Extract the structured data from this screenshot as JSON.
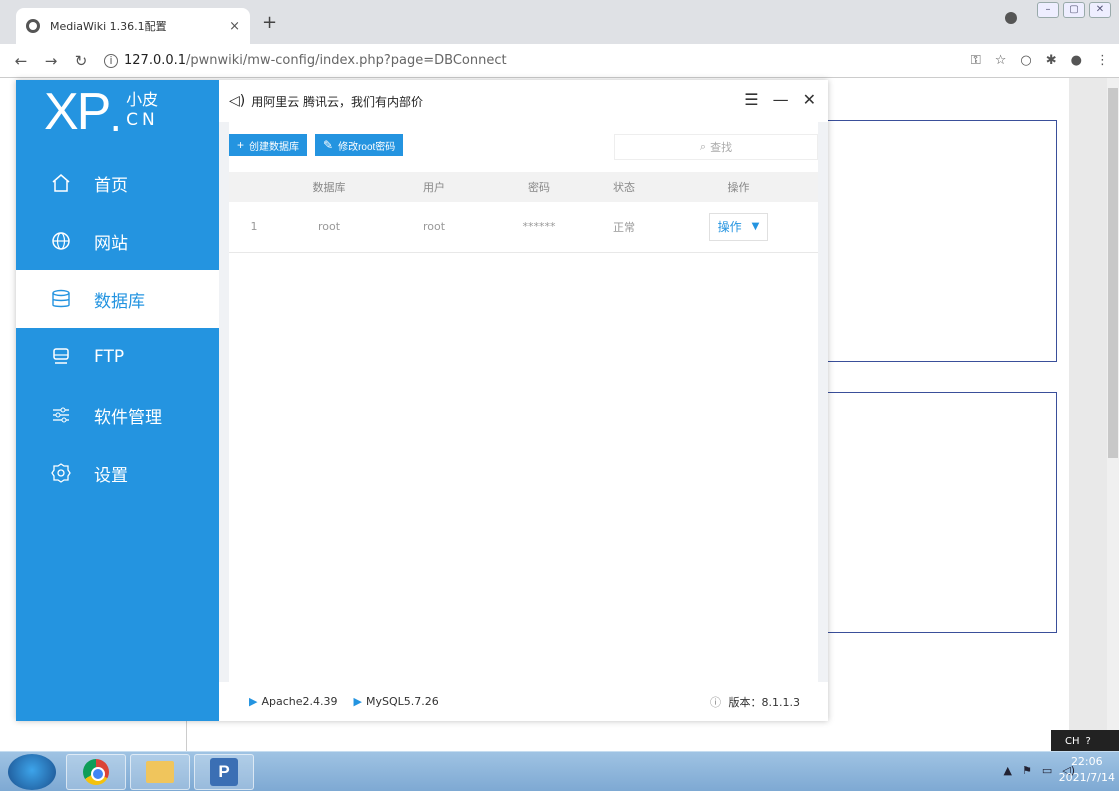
{
  "browser": {
    "tab_title": "MediaWiki 1.36.1配置",
    "tab_close": "×",
    "new_tab": "+",
    "url_host": "127.0.0.1",
    "url_path": "/pwnwiki/mw-config/index.php?page=DBConnect"
  },
  "app": {
    "logo_main": "XP",
    "logo_dot": ".",
    "logo_cn1": "小皮",
    "logo_cn2": "CN",
    "nav": [
      {
        "label": "首页",
        "icon": "home-icon"
      },
      {
        "label": "网站",
        "icon": "globe-icon"
      },
      {
        "label": "数据库",
        "icon": "database-icon",
        "active": true
      },
      {
        "label": "FTP",
        "icon": "ftp-icon"
      },
      {
        "label": "软件管理",
        "icon": "sliders-icon"
      },
      {
        "label": "设置",
        "icon": "gear-icon"
      }
    ],
    "notice": "用阿里云 腾讯云，我们有内部价",
    "toolbar": {
      "create_db": "创建数据库",
      "change_root_pw": "修改root密码",
      "search_placeholder": "查找"
    },
    "table": {
      "headers": [
        "",
        "数据库",
        "用户",
        "密码",
        "状态",
        "操作"
      ],
      "rows": [
        {
          "index": "1",
          "database": "root",
          "user": "root",
          "password": "******",
          "status": "正常",
          "action": "操作"
        }
      ]
    },
    "footer": {
      "apache": "Apache2.4.39",
      "mysql": "MySQL5.7.26",
      "version": "版本：8.1.1.3"
    }
  },
  "taskbar": {
    "lang": "CH",
    "time": "22:06",
    "date": "2021/7/14"
  },
  "colors": {
    "accent": "#2494e0"
  }
}
